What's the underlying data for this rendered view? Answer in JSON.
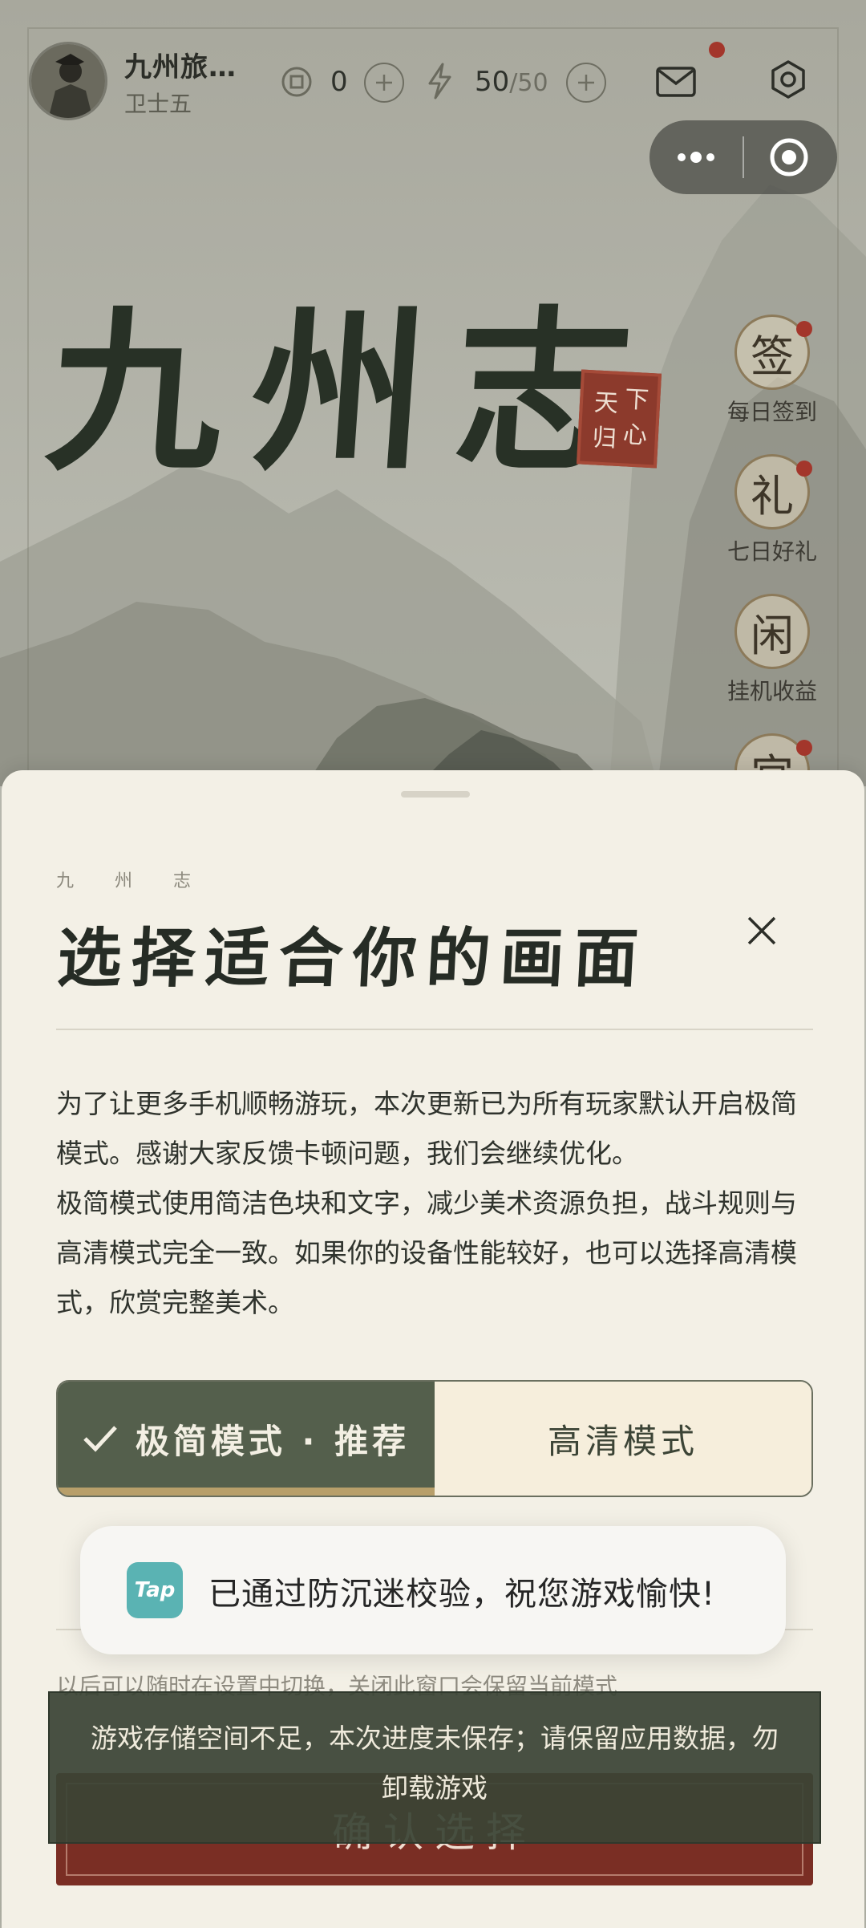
{
  "header": {
    "player_name": "九州旅…",
    "player_rank": "卫士五",
    "coins": "0",
    "energy": "50",
    "energy_max": "/50"
  },
  "title": {
    "game_name": "九州志",
    "seal_chars": [
      "天",
      "下",
      "归",
      "心"
    ]
  },
  "side_menu": [
    {
      "glyph": "签",
      "label": "每日签到",
      "badge": true
    },
    {
      "glyph": "礼",
      "label": "七日好礼",
      "badge": true
    },
    {
      "glyph": "闲",
      "label": "挂机收益",
      "badge": false
    },
    {
      "glyph": "宫",
      "label": "",
      "badge": true
    }
  ],
  "sheet": {
    "brand": "九 州 志",
    "title": "选择适合你的画面",
    "desc_p1": "为了让更多手机顺畅游玩，本次更新已为所有玩家默认开启极简模式。感谢大家反馈卡顿问题，我们会继续优化。",
    "desc_p2": "极简模式使用简洁色块和文字，减少美术资源负担，战斗规则与高清模式完全一致。如果你的设备性能较好，也可以选择高清模式，欣赏完整美术。",
    "mode_simple": "极简模式 · 推荐",
    "mode_hd": "高清模式",
    "hint": "以后可以随时在设置中切换，关闭此窗口会保留当前模式",
    "confirm": "确认选择"
  },
  "toast": {
    "logo": "Tap",
    "text": "已通过防沉迷校验，祝您游戏愉快!"
  },
  "banner": {
    "text": "游戏存储空间不足，本次进度未保存；请保留应用数据，勿卸载游戏"
  },
  "colors": {
    "accent_green": "#545f4c",
    "accent_gold": "#b89f6a",
    "confirm_red": "#7a2e24",
    "badge_red": "#a3362b"
  }
}
